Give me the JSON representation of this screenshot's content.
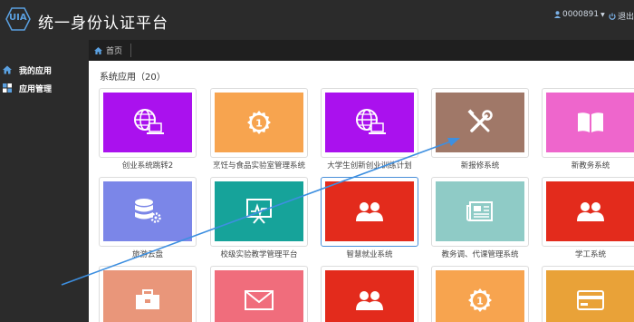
{
  "header": {
    "logo_text": "UIA",
    "title": "统一身份认证平台",
    "user": "0000891",
    "logout": "退出"
  },
  "sidebar": {
    "items": [
      {
        "label": "我的应用",
        "icon": "home-icon"
      },
      {
        "label": "应用管理",
        "icon": "grid-icon"
      }
    ]
  },
  "breadcrumb": {
    "home": "首页"
  },
  "section": {
    "title": "系统应用（20）"
  },
  "tiles": [
    {
      "label": "创业系统跳转2",
      "color": "#aa11ee",
      "icon": "globe-laptop-icon"
    },
    {
      "label": "烹饪与食品实验室管理系统",
      "color": "#f7a44f",
      "icon": "award-badge-icon"
    },
    {
      "label": "大学生创新创业训练计划",
      "color": "#aa11ee",
      "icon": "globe-laptop-icon"
    },
    {
      "label": "新报修系统",
      "color": "#a07868",
      "icon": "tools-icon"
    },
    {
      "label": "新教务系统",
      "color": "#ee66cc",
      "icon": "book-icon"
    },
    {
      "label": "旅游云盘",
      "color": "#7b86e8",
      "icon": "database-gear-icon"
    },
    {
      "label": "校级实验教学管理平台",
      "color": "#16a39a",
      "icon": "presentation-icon"
    },
    {
      "label": "智慧就业系统",
      "color": "#e32b1c",
      "icon": "users-icon"
    },
    {
      "label": "教务调、代课管理系统",
      "color": "#8fcbc6",
      "icon": "newspaper-icon"
    },
    {
      "label": "学工系统",
      "color": "#e32b1c",
      "icon": "users-icon"
    },
    {
      "label": "",
      "color": "#e9967a",
      "icon": "briefcase-icon"
    },
    {
      "label": "",
      "color": "#f06d7c",
      "icon": "envelope-icon"
    },
    {
      "label": "",
      "color": "#e32b1c",
      "icon": "users-icon"
    },
    {
      "label": "",
      "color": "#f7a44f",
      "icon": "award-badge-icon"
    },
    {
      "label": "",
      "color": "#e9a238",
      "icon": "credit-card-icon"
    }
  ]
}
